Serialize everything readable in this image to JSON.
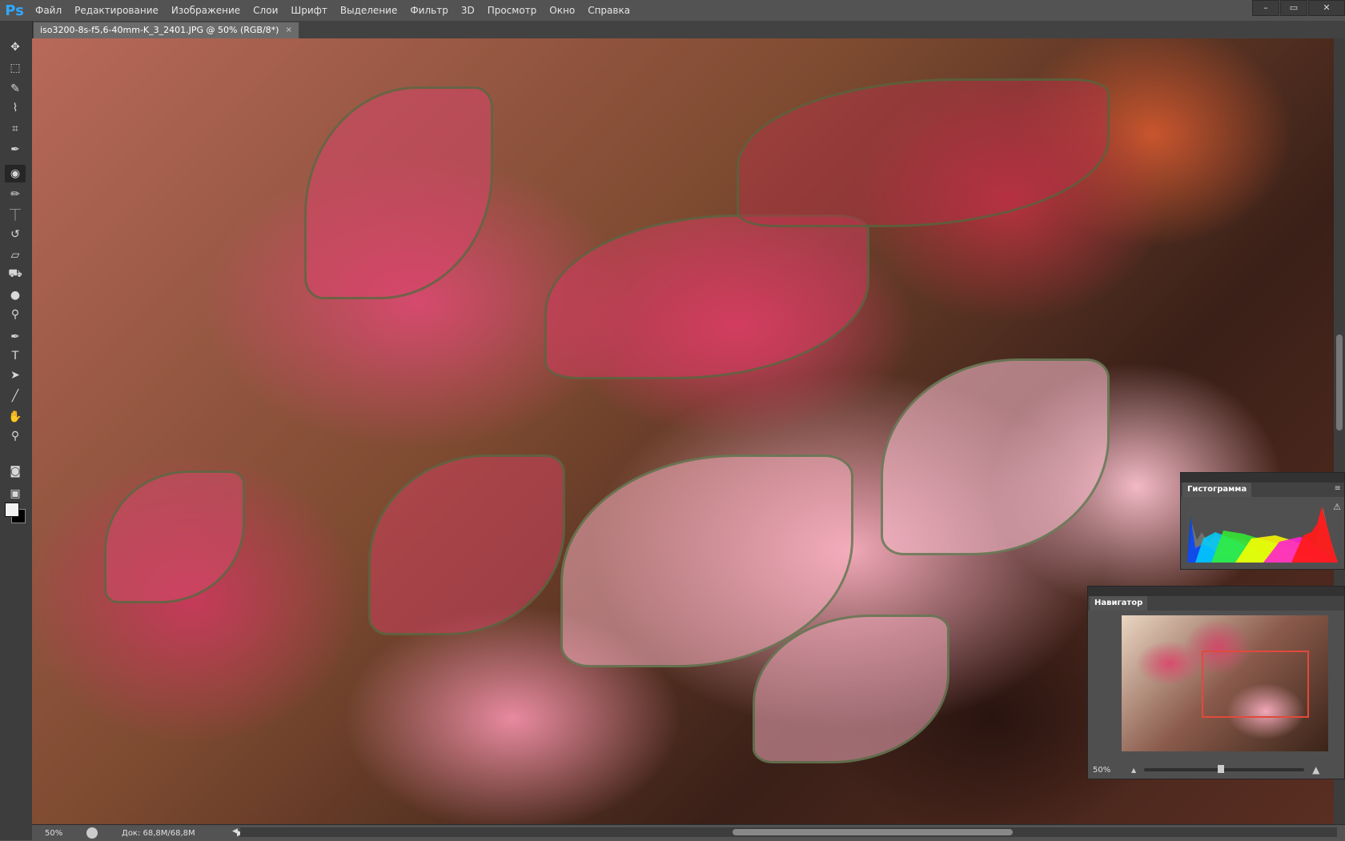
{
  "app": {
    "logo": "Ps",
    "menu": [
      "Файл",
      "Редактирование",
      "Изображение",
      "Слои",
      "Шрифт",
      "Выделение",
      "Фильтр",
      "3D",
      "Просмотр",
      "Окно",
      "Справка"
    ],
    "window_controls": [
      "–",
      "▭",
      "✕"
    ]
  },
  "document_tab": {
    "title": "iso3200-8s-f5,6-40mm-K_3_2401.JPG @ 50% (RGB/8*)",
    "close": "×"
  },
  "tools": [
    {
      "name": "move-tool",
      "glyph": "✥"
    },
    {
      "name": "marquee-tool",
      "glyph": "⬚"
    },
    {
      "name": "lasso-tool",
      "glyph": "✎"
    },
    {
      "name": "quick-select-tool",
      "glyph": "⌇"
    },
    {
      "name": "crop-tool",
      "glyph": "⌗"
    },
    {
      "name": "eyedropper-tool",
      "glyph": "✒"
    },
    {
      "name": "spot-heal-tool",
      "glyph": "◉"
    },
    {
      "name": "brush-tool",
      "glyph": "✏"
    },
    {
      "name": "stamp-tool",
      "glyph": "⏉"
    },
    {
      "name": "history-brush-tool",
      "glyph": "↺"
    },
    {
      "name": "eraser-tool",
      "glyph": "▱"
    },
    {
      "name": "paint-bucket-tool",
      "glyph": "⛟"
    },
    {
      "name": "blur-tool",
      "glyph": "●"
    },
    {
      "name": "dodge-tool",
      "glyph": "⚲"
    },
    {
      "name": "pen-tool",
      "glyph": "✒"
    },
    {
      "name": "type-tool",
      "glyph": "T"
    },
    {
      "name": "path-select-tool",
      "glyph": "➤"
    },
    {
      "name": "line-tool",
      "glyph": "╱"
    },
    {
      "name": "hand-tool",
      "glyph": "✋"
    },
    {
      "name": "zoom-tool",
      "glyph": "⚲"
    },
    {
      "name": "quick-mask-tool",
      "glyph": "◙"
    },
    {
      "name": "screen-mode-tool",
      "glyph": "▣"
    }
  ],
  "status": {
    "zoom": "50%",
    "doc_info": "Док: 68,8M/68,8M",
    "arrow": "▶"
  },
  "histogram_panel": {
    "title": "Гистограмма",
    "warning": "⚠"
  },
  "navigator_panel": {
    "title": "Навигатор",
    "zoom": "50%"
  },
  "colors": {
    "ui_dark": "#3d3d3d",
    "ui_mid": "#535353",
    "nav_view_box": "#e14a3b"
  }
}
